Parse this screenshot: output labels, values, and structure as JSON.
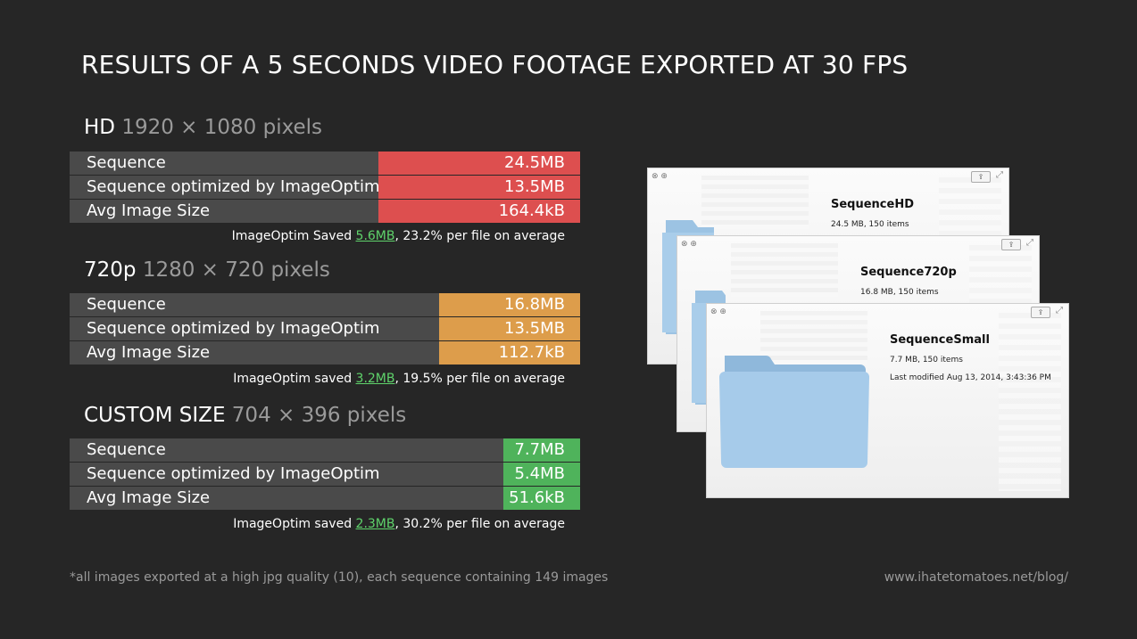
{
  "title": "RESULTS OF A 5 SECONDS VIDEO FOOTAGE EXPORTED AT 30 FPS",
  "colors": {
    "hd": "#dd4f4f",
    "p720": "#dd9d4b",
    "custom": "#4fb35b",
    "highlight": "#5fd36b",
    "row_bg": "#4a4a4a"
  },
  "chart_data": [
    {
      "type": "bar",
      "title": "HD",
      "subtitle": "1920 × 1080 pixels",
      "categories": [
        "Sequence",
        "Sequence optimized by ImageOptim",
        "Avg Image Size"
      ],
      "values": [
        24.5,
        13.5,
        164.4
      ],
      "value_labels": [
        "24.5MB",
        "13.5MB",
        "164.4kB"
      ],
      "units": [
        "MB",
        "MB",
        "kB"
      ],
      "note_prefix": "ImageOptim Saved ",
      "note_highlight": "5.6MB",
      "note_suffix": ", 23.2% per file on average"
    },
    {
      "type": "bar",
      "title": "720p",
      "subtitle": "1280 × 720 pixels",
      "categories": [
        "Sequence",
        "Sequence optimized by ImageOptim",
        "Avg Image Size"
      ],
      "values": [
        16.8,
        13.5,
        112.7
      ],
      "value_labels": [
        "16.8MB",
        "13.5MB",
        "112.7kB"
      ],
      "units": [
        "MB",
        "MB",
        "kB"
      ],
      "note_prefix": "ImageOptim saved ",
      "note_highlight": "3.2MB",
      "note_suffix": ", 19.5% per file on average"
    },
    {
      "type": "bar",
      "title": "CUSTOM SIZE",
      "subtitle": "704 × 396 pixels",
      "categories": [
        "Sequence",
        "Sequence optimized by ImageOptim",
        "Avg Image Size"
      ],
      "values": [
        7.7,
        5.4,
        51.6
      ],
      "value_labels": [
        "7.7MB",
        "5.4MB",
        "51.6kB"
      ],
      "units": [
        "MB",
        "MB",
        "kB"
      ],
      "note_prefix": "ImageOptim saved ",
      "note_highlight": "2.3MB",
      "note_suffix": ", 30.2% per file on average"
    }
  ],
  "footnote": "*all images exported at a high jpg quality (10), each sequence containing 149 images",
  "site": "www.ihatetomatoes.net/blog/",
  "windows": [
    {
      "name": "SequenceHD",
      "line1": "24.5 MB, 150 items",
      "line2": ""
    },
    {
      "name": "Sequence720p",
      "line1": "16.8 MB, 150 items",
      "line2": ""
    },
    {
      "name": "SequenceSmall",
      "line1": "7.7 MB, 150 items",
      "line2": "Last modified Aug 13, 2014, 3:43:36 PM"
    }
  ],
  "window_icons": {
    "controls": "close-minimize-icons",
    "share": "share-icon",
    "expand": "expand-icon",
    "folder": "folder-icon"
  }
}
